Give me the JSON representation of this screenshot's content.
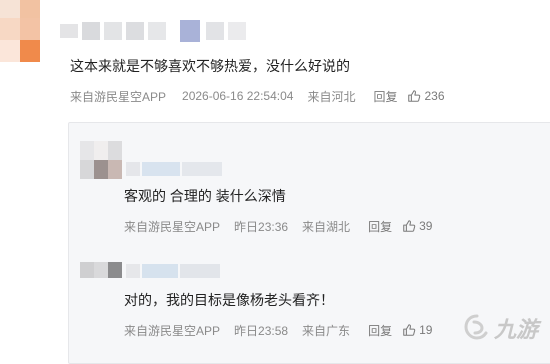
{
  "main_comment": {
    "text": "这本来就是不够喜欢不够热爱，没什么好说的",
    "source": "来自游民星空APP",
    "timestamp": "2026-06-16 22:54:04",
    "location": "来自河北",
    "reply_label": "回复",
    "likes": "236"
  },
  "replies": [
    {
      "text": "客观的 合理的 装什么深情",
      "source": "来自游民星空APP",
      "timestamp": "昨日23:36",
      "location": "来自湖北",
      "reply_label": "回复",
      "likes": "39"
    },
    {
      "text": "对的，我的目标是像杨老头看齐！",
      "source": "来自游民星空APP",
      "timestamp": "昨日23:58",
      "location": "来自广东",
      "reply_label": "回复",
      "likes": "19"
    }
  ],
  "watermark": {
    "text": "九游",
    "color": "#c8c8c8"
  },
  "colors": {
    "avatar_orange": "#f08a4b",
    "avatar_peach": "#f6cfb4",
    "name_blur_blue": "#a9b2d8"
  }
}
